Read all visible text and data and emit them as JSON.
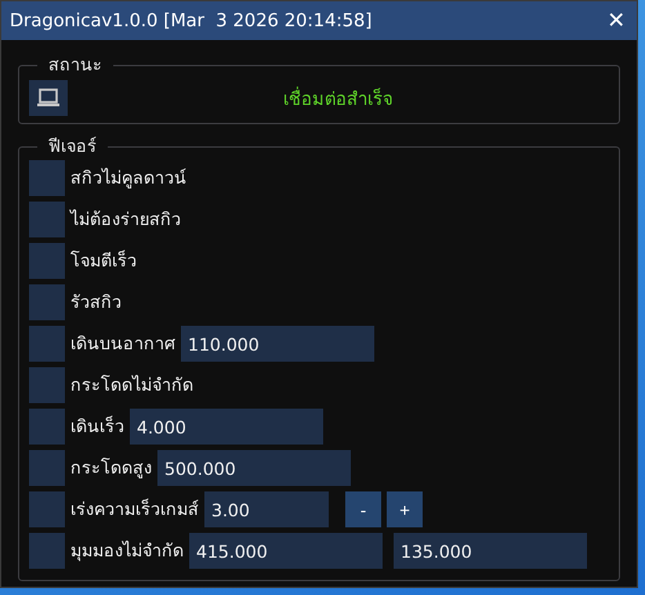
{
  "window": {
    "title": "Dragonicav1.0.0 [Mar  3 2026 20:14:58]",
    "close": "✕"
  },
  "status": {
    "title": "สถานะ",
    "message": "เชื่อมต่อสำเร็จ",
    "connected": true
  },
  "features": {
    "title": "ฟีเจอร์",
    "items": [
      {
        "kind": "toggle",
        "label": "สกิวไม่คูลดาวน์",
        "checked": false
      },
      {
        "kind": "toggle",
        "label": "ไม่ต้องร่ายสกิว",
        "checked": false
      },
      {
        "kind": "toggle",
        "label": "โจมตีเร็ว",
        "checked": false
      },
      {
        "kind": "toggle",
        "label": "รัวสกิว",
        "checked": false
      },
      {
        "kind": "input",
        "label": "เดินบนอากาศ",
        "checked": false,
        "values": [
          "110.000"
        ]
      },
      {
        "kind": "toggle",
        "label": "กระโดดไม่จำกัด",
        "checked": false
      },
      {
        "kind": "input",
        "label": "เดินเร็ว",
        "checked": false,
        "values": [
          "4.000"
        ]
      },
      {
        "kind": "input",
        "label": "กระโดดสูง",
        "checked": false,
        "values": [
          "500.000"
        ]
      },
      {
        "kind": "stepper",
        "label": "เร่งความเร็วเกมส์",
        "checked": false,
        "values": [
          "3.00"
        ],
        "buttons": [
          "-",
          "+"
        ]
      },
      {
        "kind": "input",
        "label": "มุมมองไม่จำกัด",
        "checked": false,
        "values": [
          "415.000",
          "135.000"
        ]
      }
    ]
  }
}
